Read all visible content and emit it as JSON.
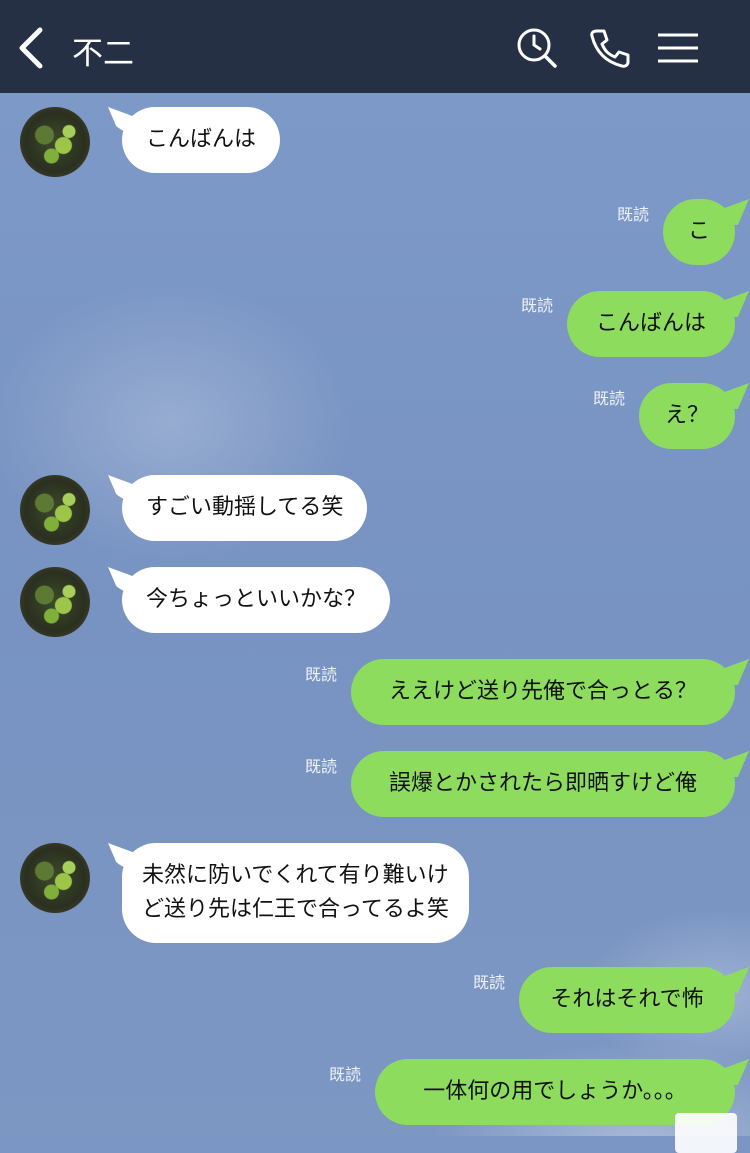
{
  "header": {
    "title": "不二"
  },
  "read_label": "既読",
  "messages": [
    {
      "side": "in",
      "lines": [
        "こんばんは"
      ]
    },
    {
      "side": "out",
      "lines": [
        "こ"
      ]
    },
    {
      "side": "out",
      "lines": [
        "こんばんは"
      ]
    },
    {
      "side": "out",
      "lines": [
        "え？"
      ]
    },
    {
      "side": "in",
      "lines": [
        "すごい動揺してる笑"
      ]
    },
    {
      "side": "in",
      "lines": [
        "今ちょっといいかな？"
      ]
    },
    {
      "side": "out",
      "lines": [
        "ええけど送り先俺で合っとる？"
      ]
    },
    {
      "side": "out",
      "lines": [
        "誤爆とかされたら即晒すけど俺"
      ]
    },
    {
      "side": "in",
      "lines": [
        "未然に防いでくれて有り難いけ",
        "ど送り先は仁王で合ってるよ笑"
      ]
    },
    {
      "side": "out",
      "lines": [
        "それはそれで怖"
      ]
    },
    {
      "side": "out",
      "lines": [
        "一体何の用でしょうか。。。"
      ]
    }
  ]
}
